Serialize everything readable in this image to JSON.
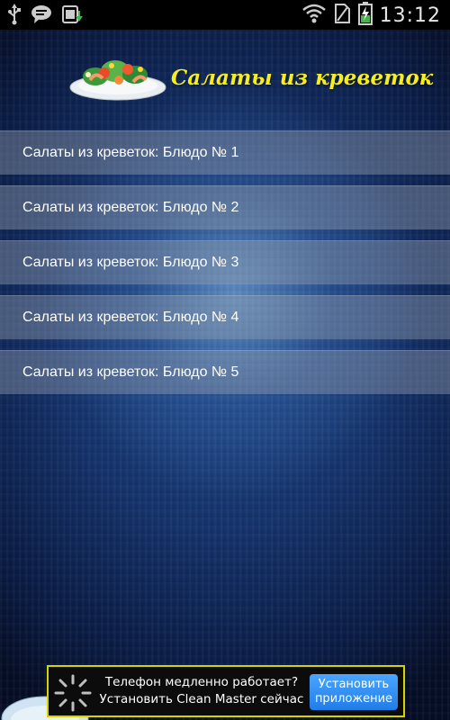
{
  "status_bar": {
    "icons": [
      "usb-icon",
      "chat-bubble-icon",
      "download-update-icon",
      "wifi-icon",
      "no-sim-icon",
      "battery-charging-icon"
    ],
    "time": "13:12"
  },
  "header": {
    "title": "Салаты из креветок"
  },
  "list": {
    "items": [
      {
        "label": "Салаты из креветок: Блюдо № 1"
      },
      {
        "label": "Салаты из креветок: Блюдо № 2"
      },
      {
        "label": "Салаты из креветок: Блюдо № 3"
      },
      {
        "label": "Салаты из креветок: Блюдо № 4"
      },
      {
        "label": "Салаты из креветок: Блюдо № 5"
      }
    ]
  },
  "ad": {
    "line1": "Телефон медленно работает?",
    "line2": "Установить Clean Master сейчас",
    "button_label": "Установить приложение",
    "border_color": "#d4d400",
    "button_color": "#2e8ff5"
  },
  "colors": {
    "title_yellow": "#f7ee1e",
    "background_blue": "#15336c"
  }
}
